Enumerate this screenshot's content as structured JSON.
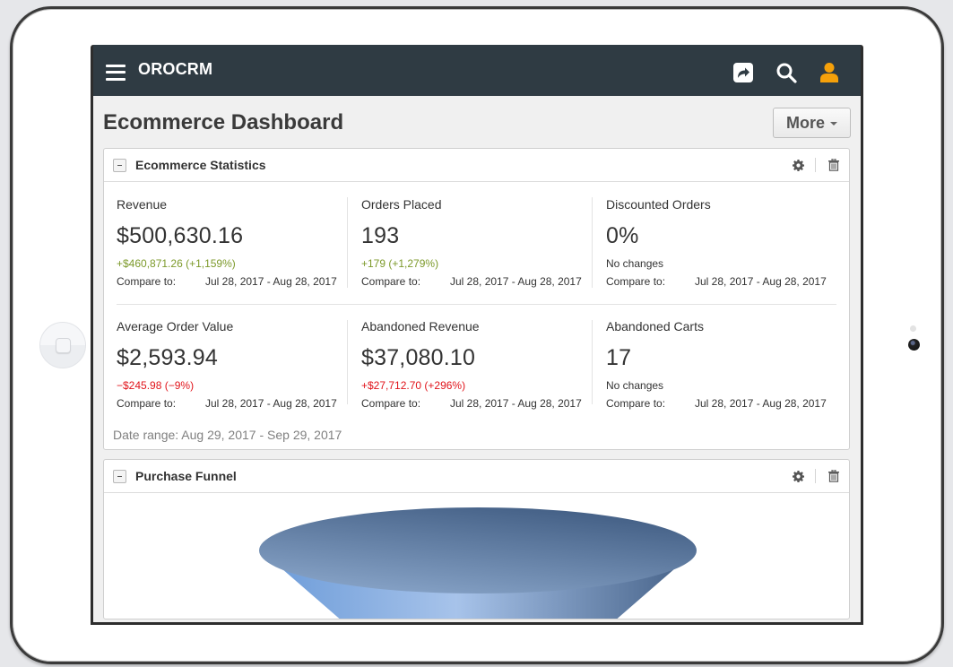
{
  "app": {
    "logo": "OROCRM"
  },
  "topbar": {
    "icons": [
      "menu-icon",
      "share-icon",
      "search-icon",
      "user-icon"
    ],
    "user_icon_color": "#f5a00a"
  },
  "page": {
    "title": "Ecommerce Dashboard",
    "more_label": "More"
  },
  "widgets": {
    "stats": {
      "title": "Ecommerce Statistics",
      "items": [
        {
          "label": "Revenue",
          "value": "$500,630.16",
          "change": "+$460,871.26 (+1,159%)",
          "change_type": "positive",
          "compare_label": "Compare to:",
          "compare_range": "Jul 28, 2017 - Aug 28, 2017"
        },
        {
          "label": "Orders Placed",
          "value": "193",
          "change": "+179 (+1,279%)",
          "change_type": "positive",
          "compare_label": "Compare to:",
          "compare_range": "Jul 28, 2017 - Aug 28, 2017"
        },
        {
          "label": "Discounted Orders",
          "value": "0%",
          "change": "No changes",
          "change_type": "neutral",
          "compare_label": "Compare to:",
          "compare_range": "Jul 28, 2017 - Aug 28, 2017"
        },
        {
          "label": "Average Order Value",
          "value": "$2,593.94",
          "change": "−$245.98 (−9%)",
          "change_type": "negative",
          "compare_label": "Compare to:",
          "compare_range": "Jul 28, 2017 - Aug 28, 2017"
        },
        {
          "label": "Abandoned Revenue",
          "value": "$37,080.10",
          "change": "+$27,712.70 (+296%)",
          "change_type": "negative",
          "compare_label": "Compare to:",
          "compare_range": "Jul 28, 2017 - Aug 28, 2017"
        },
        {
          "label": "Abandoned Carts",
          "value": "17",
          "change": "No changes",
          "change_type": "neutral",
          "compare_label": "Compare to:",
          "compare_range": "Jul 28, 2017 - Aug 28, 2017"
        }
      ],
      "date_range": "Date range: Aug 29, 2017 - Sep 29, 2017"
    },
    "funnel": {
      "title": "Purchase Funnel"
    }
  },
  "colors": {
    "topbar_bg": "#2f3b43",
    "positive": "#7d9a2b",
    "negative": "#e1141b",
    "funnel_dark": "#435f85",
    "funnel_light": "#a7c3ea"
  }
}
